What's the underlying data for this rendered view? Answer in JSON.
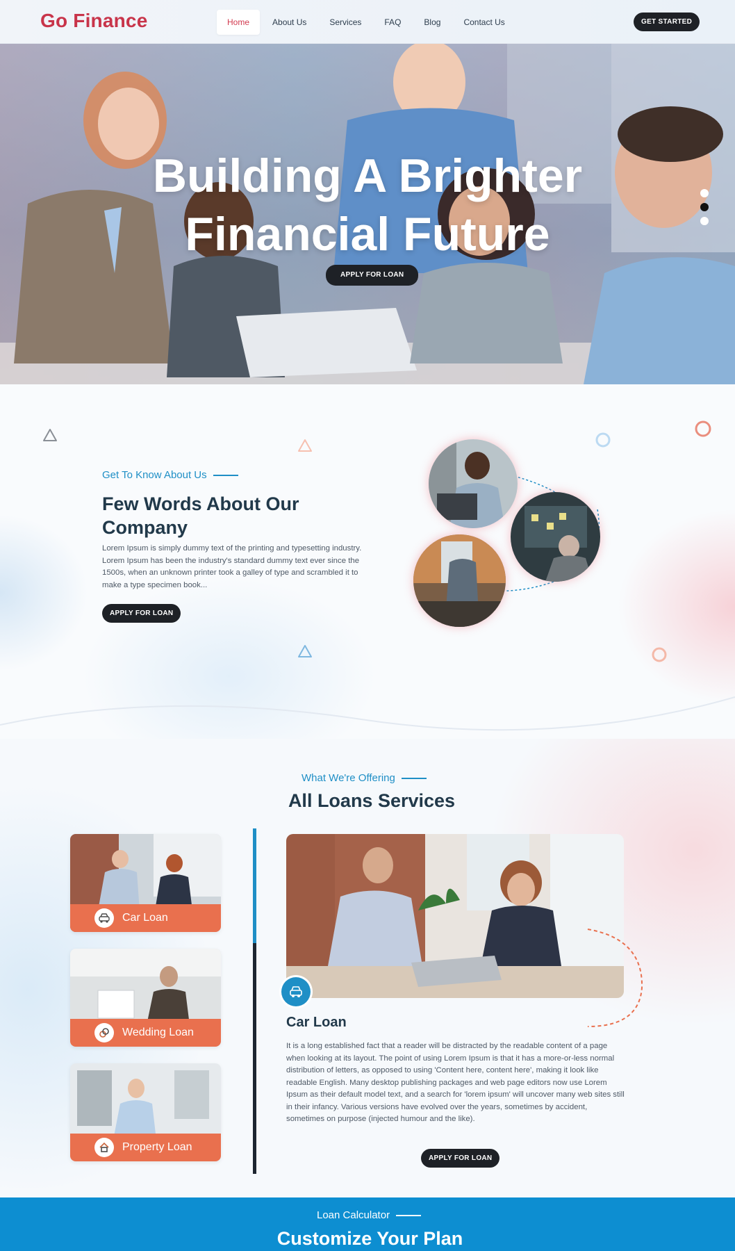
{
  "brand": {
    "name": "Go Finance"
  },
  "nav": {
    "items": [
      "Home",
      "About Us",
      "Services",
      "FAQ",
      "Blog",
      "Contact Us"
    ],
    "active_index": 0,
    "cta": "GET STARTED"
  },
  "hero": {
    "title_line1": "Building A Brighter",
    "title_line2": "Financial Future",
    "cta": "APPLY FOR LOAN",
    "slides": 3,
    "active_slide": 2
  },
  "about": {
    "eyebrow": "Get To Know About Us",
    "title": "Few Words About Our Company",
    "text": "Lorem Ipsum is simply dummy text of the printing and typesetting industry. Lorem Ipsum has been the industry's standard dummy text ever since the 1500s, when an unknown printer took a galley of type and scrambled it to make a type specimen book...",
    "cta": "APPLY FOR LOAN"
  },
  "loans": {
    "eyebrow": "What We're Offering",
    "title": "All Loans Services",
    "cards": [
      {
        "label": "Car Loan",
        "icon": "car-icon"
      },
      {
        "label": "Wedding Loan",
        "icon": "wedding-icon"
      },
      {
        "label": "Property Loan",
        "icon": "property-icon"
      }
    ],
    "selected": {
      "title": "Car Loan",
      "text": "It is a long established fact that a reader will be distracted by the readable content of a page when looking at its layout. The point of using Lorem Ipsum is that it has a more-or-less normal distribution of letters, as opposed to using 'Content here, content here', making it look like readable English. Many desktop publishing packages and web page editors now use Lorem Ipsum as their default model text, and a search for 'lorem ipsum' will uncover many web sites still in their infancy. Various versions have evolved over the years, sometimes by accident, sometimes on purpose (injected humour and the like).",
      "cta": "APPLY FOR LOAN",
      "icon": "car-icon"
    }
  },
  "calculator": {
    "eyebrow": "Loan Calculator",
    "title": "Customize Your Plan"
  },
  "colors": {
    "brand_red": "#c8344a",
    "accent_blue": "#1f8fc6",
    "accent_orange": "#e9704e",
    "dark": "#1e2126"
  }
}
